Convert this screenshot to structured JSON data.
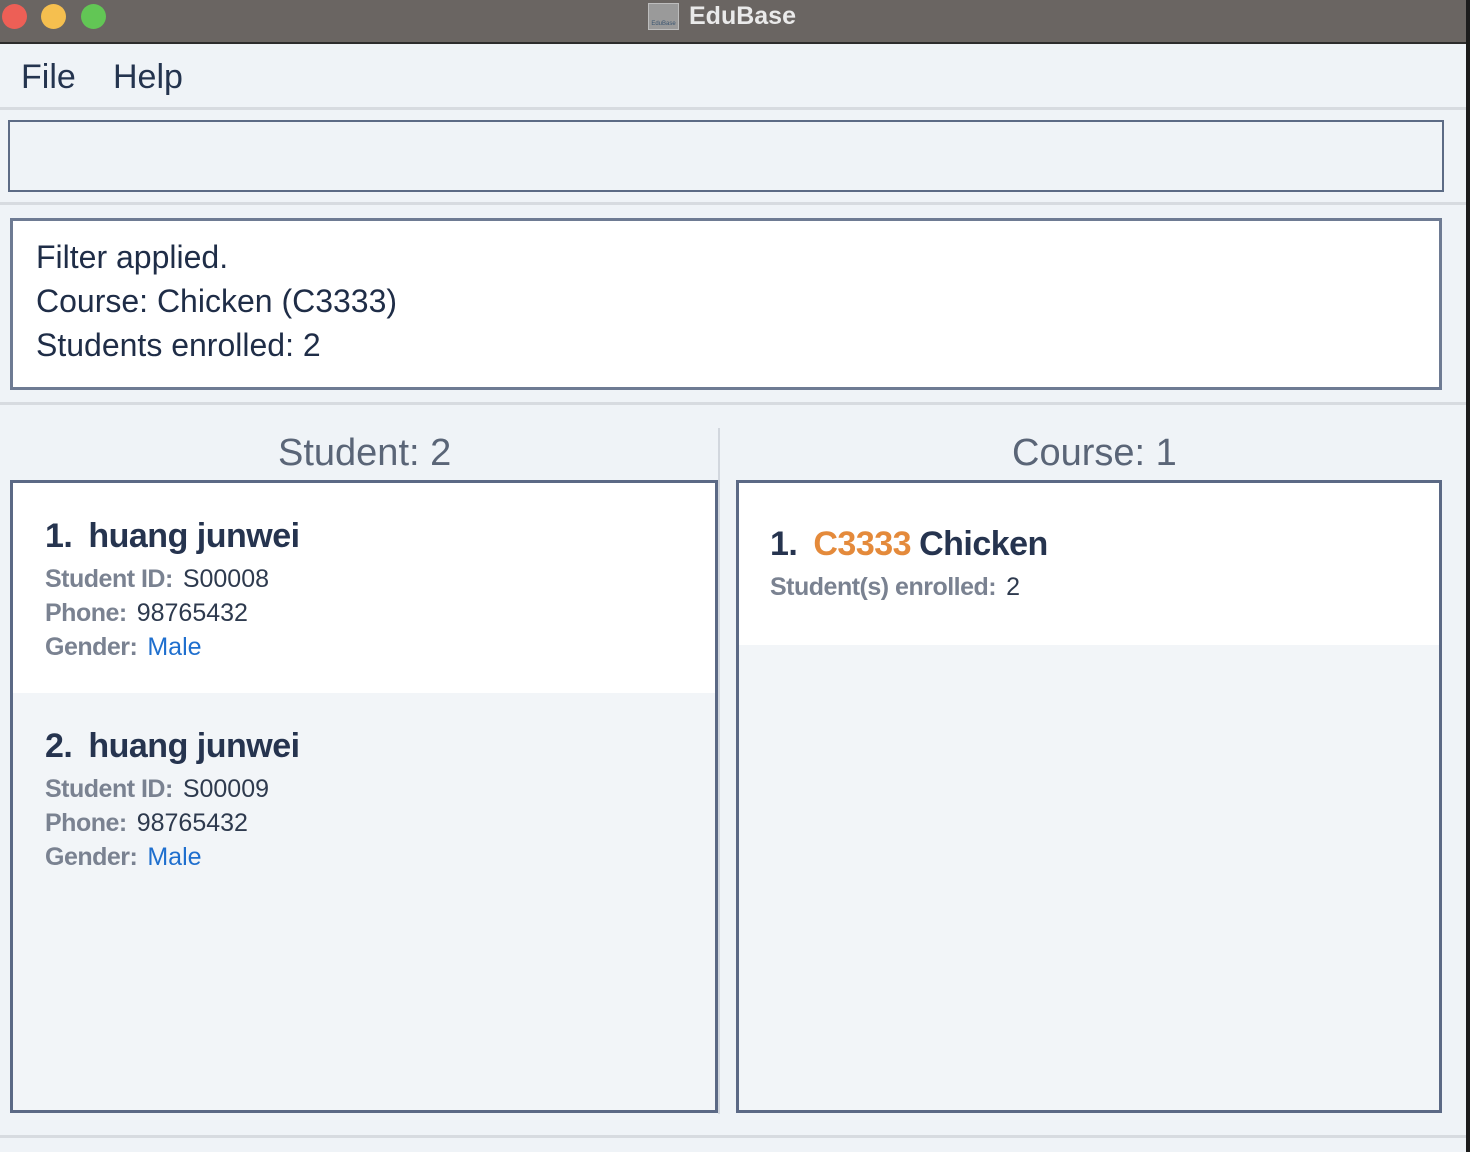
{
  "window": {
    "title": "EduBase",
    "icon_label": "EduBase"
  },
  "menu": {
    "file": "File",
    "help": "Help"
  },
  "command": {
    "value": ""
  },
  "result": {
    "lines": [
      "Filter applied.",
      "Course: Chicken (C3333)",
      "Students enrolled: 2"
    ]
  },
  "student_panel": {
    "header": "Student: 2",
    "students": [
      {
        "index": "1.",
        "name": "huang junwei",
        "id_label": "Student ID:",
        "id": "S00008",
        "phone_label": "Phone:",
        "phone": "98765432",
        "gender_label": "Gender:",
        "gender": "Male"
      },
      {
        "index": "2.",
        "name": "huang junwei",
        "id_label": "Student ID:",
        "id": "S00009",
        "phone_label": "Phone:",
        "phone": "98765432",
        "gender_label": "Gender:",
        "gender": "Male"
      }
    ]
  },
  "course_panel": {
    "header": "Course: 1",
    "courses": [
      {
        "index": "1.",
        "code": "C3333",
        "name": "Chicken",
        "enrolled_label": "Student(s) enrolled:",
        "enrolled": "2"
      }
    ]
  },
  "colors": {
    "course_code": "#e48a3b",
    "gender_value": "#1f6fce",
    "title_bar": "#6a6562"
  }
}
